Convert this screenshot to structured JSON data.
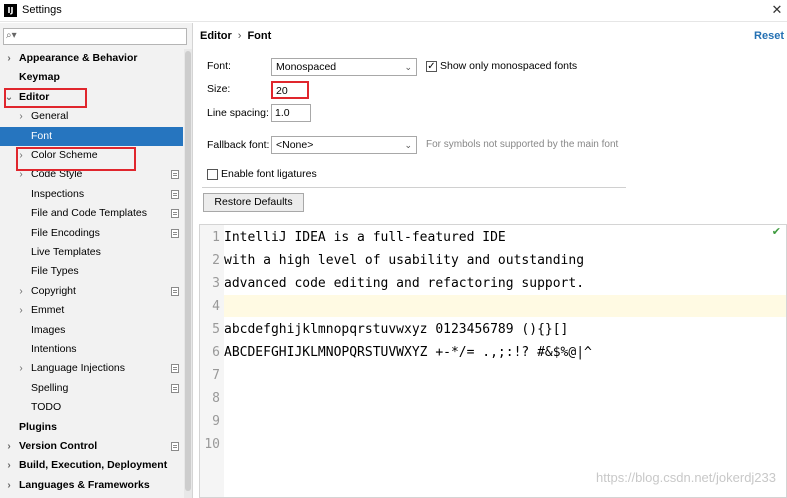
{
  "window": {
    "title": "Settings",
    "close_glyph": "✕"
  },
  "sidebar": {
    "search": {
      "value": "",
      "placeholder": ""
    },
    "items": [
      {
        "label": "Appearance & Behavior",
        "level": 0,
        "arrow": "›",
        "bold": true
      },
      {
        "label": "Keymap",
        "level": 0,
        "arrow": "",
        "bold": true
      },
      {
        "label": "Editor",
        "level": 0,
        "arrow": "⌄",
        "bold": true
      },
      {
        "label": "General",
        "level": 1,
        "arrow": "›"
      },
      {
        "label": "Font",
        "level": 1,
        "arrow": "",
        "selected": true
      },
      {
        "label": "Color Scheme",
        "level": 1,
        "arrow": "›"
      },
      {
        "label": "Code Style",
        "level": 1,
        "arrow": "›",
        "project": true
      },
      {
        "label": "Inspections",
        "level": 1,
        "arrow": "",
        "project": true
      },
      {
        "label": "File and Code Templates",
        "level": 1,
        "arrow": "",
        "project": true
      },
      {
        "label": "File Encodings",
        "level": 1,
        "arrow": "",
        "project": true
      },
      {
        "label": "Live Templates",
        "level": 1,
        "arrow": ""
      },
      {
        "label": "File Types",
        "level": 1,
        "arrow": ""
      },
      {
        "label": "Copyright",
        "level": 1,
        "arrow": "›",
        "project": true
      },
      {
        "label": "Emmet",
        "level": 1,
        "arrow": "›"
      },
      {
        "label": "Images",
        "level": 1,
        "arrow": ""
      },
      {
        "label": "Intentions",
        "level": 1,
        "arrow": ""
      },
      {
        "label": "Language Injections",
        "level": 1,
        "arrow": "›",
        "project": true
      },
      {
        "label": "Spelling",
        "level": 1,
        "arrow": "",
        "project": true
      },
      {
        "label": "TODO",
        "level": 1,
        "arrow": ""
      },
      {
        "label": "Plugins",
        "level": 0,
        "arrow": "",
        "bold": true
      },
      {
        "label": "Version Control",
        "level": 0,
        "arrow": "›",
        "bold": true,
        "project": true
      },
      {
        "label": "Build, Execution, Deployment",
        "level": 0,
        "arrow": "›",
        "bold": true
      },
      {
        "label": "Languages & Frameworks",
        "level": 0,
        "arrow": "›",
        "bold": true
      }
    ]
  },
  "main": {
    "breadcrumb": {
      "parent": "Editor",
      "separator": "›",
      "current": "Font"
    },
    "reset_label": "Reset",
    "font": {
      "label": "Font:",
      "value": "Monospaced"
    },
    "monospaced_only": {
      "label": "Show only monospaced fonts",
      "checked": true
    },
    "size": {
      "label": "Size:",
      "value": "20"
    },
    "line_spacing": {
      "label": "Line spacing:",
      "value": "1.0"
    },
    "fallback": {
      "label": "Fallback font:",
      "value": "<None>",
      "hint": "For symbols not supported by the main font"
    },
    "ligatures": {
      "label": "Enable font ligatures",
      "checked": false
    },
    "restore_label": "Restore Defaults",
    "preview": {
      "lines": [
        {
          "no": "1",
          "text": "IntelliJ IDEA is a full-featured IDE"
        },
        {
          "no": "2",
          "text": "with a high level of usability and outstanding"
        },
        {
          "no": "3",
          "text": "advanced code editing and refactoring support."
        },
        {
          "no": "4",
          "text": ""
        },
        {
          "no": "5",
          "text": "abcdefghijklmnopqrstuvwxyz 0123456789 (){}[]"
        },
        {
          "no": "6",
          "text": "ABCDEFGHIJKLMNOPQRSTUVWXYZ +-*/= .,;:!? #&$%@|^"
        },
        {
          "no": "7",
          "text": ""
        },
        {
          "no": "8",
          "text": ""
        },
        {
          "no": "9",
          "text": ""
        },
        {
          "no": "10",
          "text": ""
        }
      ],
      "current_line": "4"
    },
    "watermark": "https://blog.csdn.net/jokerdj233"
  }
}
